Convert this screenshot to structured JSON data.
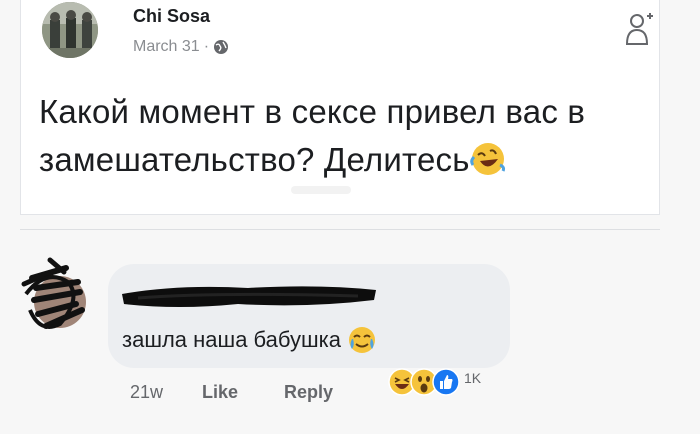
{
  "post": {
    "author": "Chi Sosa",
    "date": "March 31",
    "separator": "·",
    "text": "Какой момент в сексе привел вас в замешательство? Делитесь",
    "emoji": "rolling-on-floor-laughing-emoji"
  },
  "comment": {
    "author_redacted": true,
    "text": "зашла наша бабушка",
    "emoji": "crying-laughing-emoji",
    "time": "21w",
    "like_label": "Like",
    "reply_label": "Reply",
    "reaction_count": "1K",
    "reactions": [
      "haha-icon",
      "wow-icon",
      "like-icon"
    ]
  },
  "colors": {
    "text_primary": "#1c1e21",
    "text_secondary": "#65676b",
    "bubble_bg": "#eceef1",
    "like_blue": "#1877f2",
    "emoji_yellow": "#f5c33b"
  }
}
